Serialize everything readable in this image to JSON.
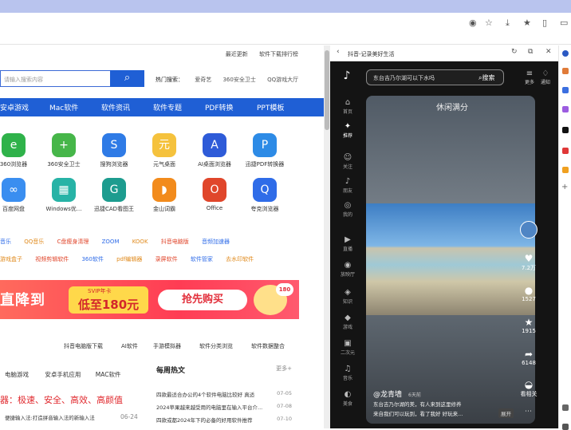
{
  "toolbar": {
    "icons": [
      "eye-off-icon",
      "star-icon",
      "download-icon",
      "favorites-icon",
      "split-icon"
    ]
  },
  "top_links": [
    "最近更新",
    "软件下载排行榜"
  ],
  "search": {
    "placeholder": "请输入搜索内容",
    "hot_label": "热门搜索：",
    "hot_terms": [
      "爱奇艺",
      "360安全卫士",
      "QQ游戏大厅"
    ]
  },
  "nav": [
    "安卓游戏",
    "Mac软件",
    "软件资讯",
    "软件专题",
    "PDF转换",
    "PPT模板"
  ],
  "apps": [
    {
      "name": "360浏览器",
      "color": "#2fb24a",
      "glyph": "e"
    },
    {
      "name": "360安全卫士",
      "color": "#46b649",
      "glyph": "+"
    },
    {
      "name": "搜狗浏览器",
      "color": "#2f7be6",
      "glyph": "S"
    },
    {
      "name": "元气桌面",
      "color": "#f5c23d",
      "glyph": "元"
    },
    {
      "name": "AI桌面浏览器",
      "color": "#2e5bd8",
      "glyph": "A"
    },
    {
      "name": "迅捷PDF转换器",
      "color": "#2d8be6",
      "glyph": "P"
    },
    {
      "name": "百度网盘",
      "color": "#3a8ef0",
      "glyph": "∞"
    },
    {
      "name": "Windows优...",
      "color": "#27b3a6",
      "glyph": "▦"
    },
    {
      "name": "迅捷CAD看图王",
      "color": "#1d9c8f",
      "glyph": "G"
    },
    {
      "name": "金山词霸",
      "color": "#f28b1c",
      "glyph": "◗"
    },
    {
      "name": "Office",
      "color": "#e0462b",
      "glyph": "O"
    },
    {
      "name": "夸克浏览器",
      "color": "#2f6ce8",
      "glyph": "Q"
    }
  ],
  "link_row1": [
    "音乐",
    "QQ音乐",
    "C盘瘦身清理",
    "ZOOM",
    "KOOK",
    "抖音电脑版",
    "音频加速器"
  ],
  "link_row2": [
    "游戏盒子",
    "视频剪辑软件",
    "360软件",
    "pdf编辑器",
    "录屏软件",
    "软件管家",
    "去水印软件"
  ],
  "banner": {
    "left": "直降到",
    "svip": "SVIP年卡",
    "mid": "低至180元",
    "btn": "抢先购买",
    "badge": "180"
  },
  "sub_tabs": [
    "抖音电脑版下载",
    "AI软件",
    "手游模拟器",
    "软件分类浏览",
    "软件数据整合"
  ],
  "left_tabs": [
    "电脑游戏",
    "安卓手机应用",
    "MAC软件"
  ],
  "left_red": "器：极速、安全、高效、高颜值",
  "left_item": {
    "text": "便捷输入法:打造拼音输入法的新输入法",
    "date": "06-24"
  },
  "news": {
    "title": "每周热文",
    "more": "更多+",
    "items": [
      {
        "t": "四款最适合办公的4个软件电脑比较好 真适",
        "d": "07-05"
      },
      {
        "t": "2024苹果越来越受用的电脑里在输入平台介...",
        "d": "07-08"
      },
      {
        "t": "四款或都2024年下的必备的好用软件推荐",
        "d": "07-10"
      }
    ]
  },
  "side": {
    "url": "抖音-记录美好生活",
    "search_value": "东台吉乃尔湖可以下水吗",
    "search_btn": "搜索",
    "right_labels": [
      "更多",
      "通知"
    ]
  },
  "side_nav": [
    [
      "⌂",
      "首页"
    ],
    [
      "✦",
      "推荐"
    ],
    [
      "☺",
      "关注"
    ],
    [
      "♪",
      "朋友"
    ],
    [
      "◎",
      "我的"
    ],
    [
      "▶",
      "直播"
    ],
    [
      "◉",
      "放映厅"
    ],
    [
      "◈",
      "知识"
    ],
    [
      "◆",
      "游戏"
    ],
    [
      "▣",
      "二次元"
    ],
    [
      "♫",
      "音乐"
    ],
    [
      "◐",
      "美食"
    ]
  ],
  "video": {
    "tag": "休闲满分",
    "likes": "7.2万",
    "comments": "1527",
    "stars": "1915",
    "shares": "6148",
    "recommend": "看相关",
    "author": "@龙青墙",
    "time": "6天前",
    "desc": "东台吉乃尔湖的美，有人来到这里修养",
    "desc2": "来自我们可以玩到，看了我好 好玩来...",
    "expand": "展开"
  }
}
